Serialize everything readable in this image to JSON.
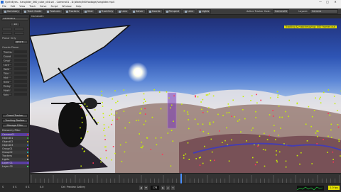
{
  "window": {
    "title": "SynthEyes - hanglider_360_cube_v04.sni - Camera01 - D:/Work/360Footage/hanglider.mp4",
    "minimize": "—",
    "maximize": "□",
    "close": "✕"
  },
  "menu": [
    "File",
    "Edit",
    "View",
    "Track",
    "Solve",
    "Script",
    "Window",
    "Help"
  ],
  "toolbar": {
    "buttons": [
      "Summary",
      "Track Guide",
      "Features",
      "Trackers",
      "Shot",
      "TrackOnly",
      "Lens",
      "Solver",
      "Coords",
      "Perspect",
      "Lens",
      "Lights"
    ],
    "active_tracker_label": "Active Tracker Host:",
    "active_tracker_value": "Camera01",
    "layout_label": "Layout:",
    "layout_value": "Camera"
  },
  "left_panel": {
    "header": "Camera01",
    "frame_value": "18",
    "planar_label": "Planar Only",
    "planar_value": "Ignore",
    "section_label": "Coords Planar",
    "ops": [
      "Tracker",
      "Coord",
      "Cmpl",
      "Lock",
      "Weld",
      "Thin",
      "Mnt",
      "Auto",
      "Delay",
      "Hash",
      "Kalu"
    ],
    "buttons": [
      "Coord Tracker",
      "Tracking Toolbar",
      "Manage Filter"
    ],
    "clips_header": "Hierarchy Filter",
    "clips": [
      {
        "name": "Camera01",
        "color": "#cc3333",
        "selected": true
      },
      {
        "name": "Object01",
        "color": "#33aa33",
        "selected": false
      },
      {
        "name": "Object02",
        "color": "#aaaa22",
        "selected": false
      },
      {
        "name": "Object03",
        "color": "#3366cc",
        "selected": false
      },
      {
        "name": "Group01",
        "color": "#cc33cc",
        "selected": false
      },
      {
        "name": "Group02",
        "color": "#22aaaa",
        "selected": false
      },
      {
        "name": "Trackers",
        "color": "#dd8822",
        "selected": false
      },
      {
        "name": "Lights",
        "color": "#aaaaaa",
        "selected": false
      },
      {
        "name": "Layer 01",
        "color": "#6644cc",
        "selected": true
      },
      {
        "name": "Layer 02",
        "color": "#44cc66",
        "selected": false
      }
    ]
  },
  "viewport": {
    "title": "Camera01",
    "overlay_tag": "Tracking & matchmoving: 000 frames out"
  },
  "timeline": {
    "start": "0",
    "end": "450"
  },
  "status": {
    "left1": "S",
    "left2": "0 S",
    "left3": "0 S",
    "left4": "0.0",
    "left5": "Cel: Preview Gallery",
    "frame": "178",
    "right_value": "1.0 fps"
  }
}
